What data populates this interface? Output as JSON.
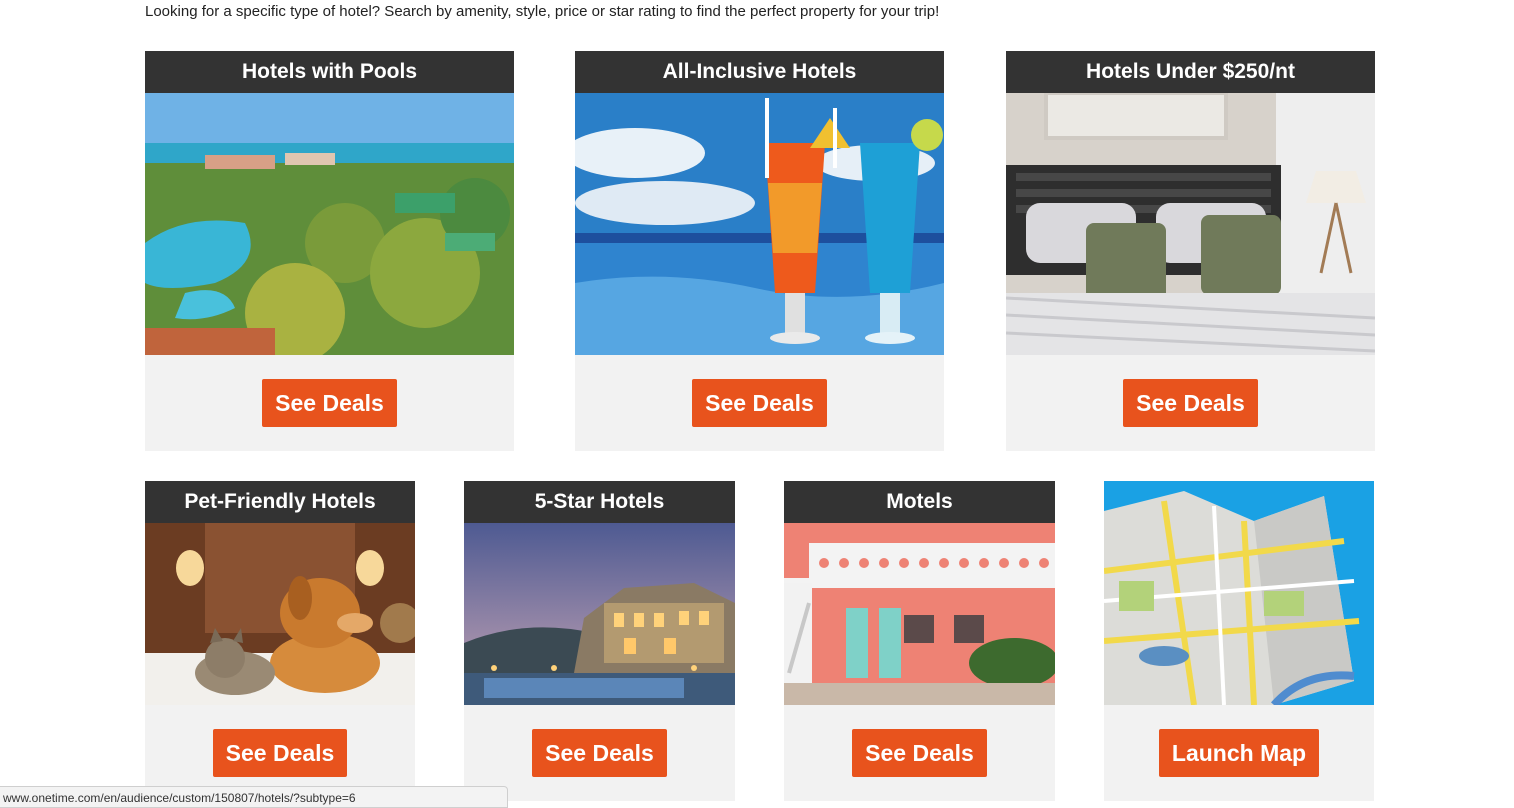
{
  "intro_text": "Looking for a specific type of hotel? Search by amenity, style, price or star rating to find the perfect property for your trip!",
  "cards": [
    {
      "title": "Hotels with Pools",
      "button": "See Deals",
      "image": "resort-pool-image"
    },
    {
      "title": "All-Inclusive Hotels",
      "button": "See Deals",
      "image": "tropical-drinks-image"
    },
    {
      "title": "Hotels Under $250/nt",
      "button": "See Deals",
      "image": "hotel-bed-image"
    },
    {
      "title": "Pet-Friendly Hotels",
      "button": "See Deals",
      "image": "dog-and-cat-image"
    },
    {
      "title": "5-Star Hotels",
      "button": "See Deals",
      "image": "luxury-villa-image"
    },
    {
      "title": "Motels",
      "button": "See Deals",
      "image": "motel-building-image"
    },
    {
      "title": "",
      "button": "Launch Map",
      "image": "map-image"
    }
  ],
  "status_url": "www.onetime.com/en/audience/custom/150807/hotels/?subtype=6",
  "colors": {
    "title_bar": "#333333",
    "button": "#e8531d",
    "card_bg": "#f2f2f2"
  }
}
